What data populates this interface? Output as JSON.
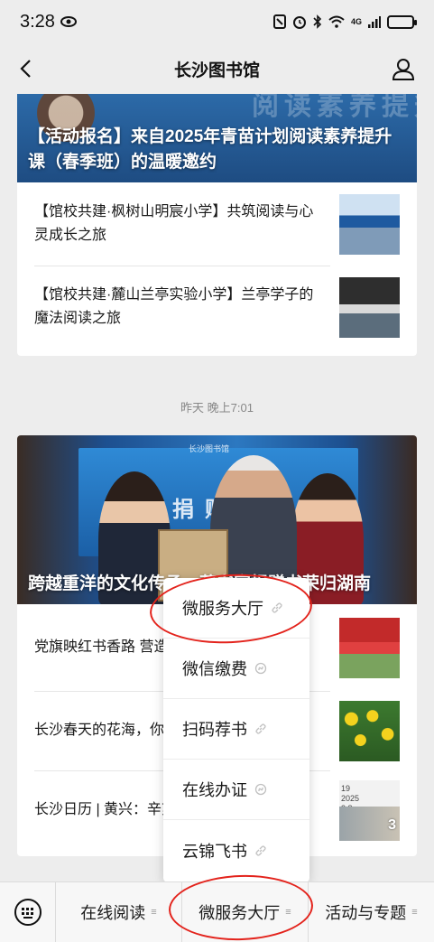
{
  "status_bar": {
    "time": "3:28",
    "network": "4G"
  },
  "nav": {
    "title": "长沙图书馆"
  },
  "card1": {
    "banner_title": "【活动报名】来自2025年青苗计划阅读素养提升课（春季班）的温暖邀约",
    "banner_deco": "阅读素养提升课",
    "articles": [
      {
        "title": "【馆校共建·枫树山明宸小学】共筑阅读与心灵成长之旅"
      },
      {
        "title": "【馆校共建·麓山兰亭实验小学】兰亭学子的魔法阅读之旅"
      }
    ]
  },
  "timestamp": "昨天 晚上7:01",
  "card2": {
    "banner_title": "跨越重洋的文化传承，藏书家捐赠书荣归湖南",
    "banner_wall_text": "文献捐赠仪式",
    "banner_logo": "长沙图书馆",
    "articles": [
      {
        "title": "党旗映红书香路  营造全民阅读好氛围"
      },
      {
        "title": "长沙春天的花海，你去过吗"
      },
      {
        "title": "长沙日历 | 黄兴：辛亥革命元勋"
      }
    ],
    "thumb_date": "19\n2025\n3 8",
    "thumb_count": "3"
  },
  "popup": {
    "items": [
      {
        "label": "微服务大厅"
      },
      {
        "label": "微信缴费"
      },
      {
        "label": "扫码荐书"
      },
      {
        "label": "在线办证"
      },
      {
        "label": "云锦飞书"
      }
    ]
  },
  "bottom_menu": {
    "items": [
      {
        "label": "在线阅读"
      },
      {
        "label": "微服务大厅"
      },
      {
        "label": "活动与专题"
      }
    ]
  },
  "colors": {
    "annotation_red": "#e3231c",
    "background": "#ededed"
  }
}
